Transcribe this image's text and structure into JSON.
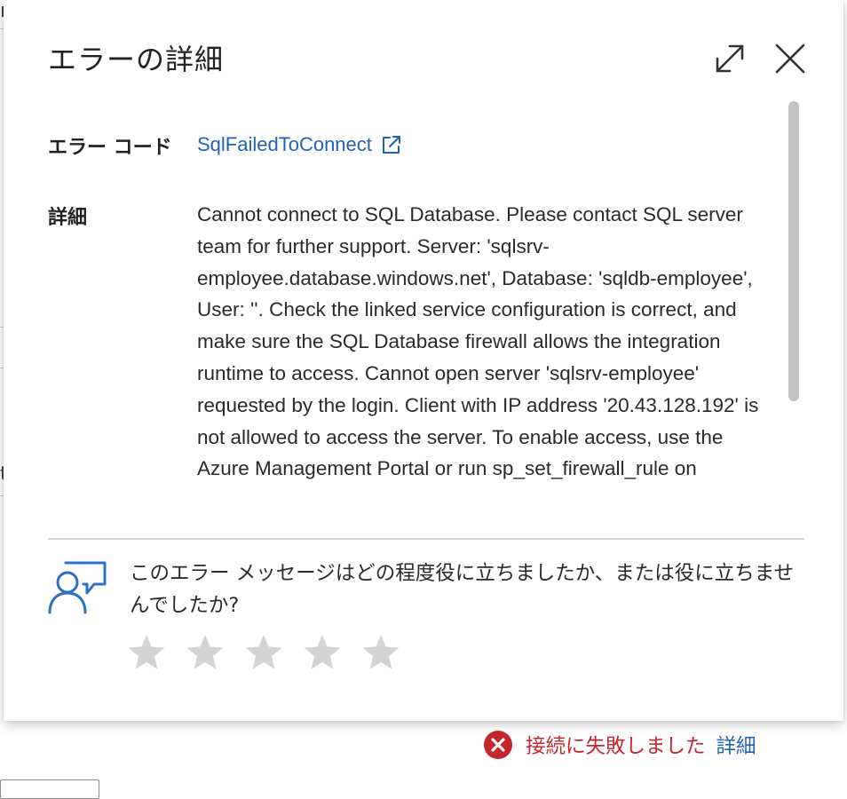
{
  "background": {
    "edge_chars": [
      "n",
      "t"
    ]
  },
  "dialog": {
    "title": "エラーの詳細",
    "expand_icon": "expand-diagonal-arrows-icon",
    "close_icon": "close-x-icon"
  },
  "error": {
    "code_label": "エラー コード",
    "code_value": "SqlFailedToConnect",
    "code_link_icon": "external-link-icon",
    "details_label": "詳細",
    "details_text": "Cannot connect to SQL Database. Please contact SQL server team for further support. Server: 'sqlsrv-employee.database.windows.net', Database: 'sqldb-employee', User: ''. Check the linked service configuration is correct, and make sure the SQL Database firewall allows the integration runtime to access. Cannot open server 'sqlsrv-employee' requested by the login. Client with IP address '20.43.128.192' is not allowed to access the server. To enable access, use the Azure Management Portal or run sp_set_firewall_rule on"
  },
  "feedback": {
    "icon": "person-feedback-icon",
    "question": "このエラー メッセージはどの程度役に立ちましたか、または役に立ちませんでしたか?",
    "rating_max": 5,
    "rating_value": 0
  },
  "status": {
    "icon": "error-circle-icon",
    "message": "接続に失敗しました",
    "link": "詳細"
  },
  "colors": {
    "link": "#1f62b8",
    "error": "#c4262e",
    "star_empty": "#d4d4d4",
    "icon_blue": "#2d6fc4"
  }
}
